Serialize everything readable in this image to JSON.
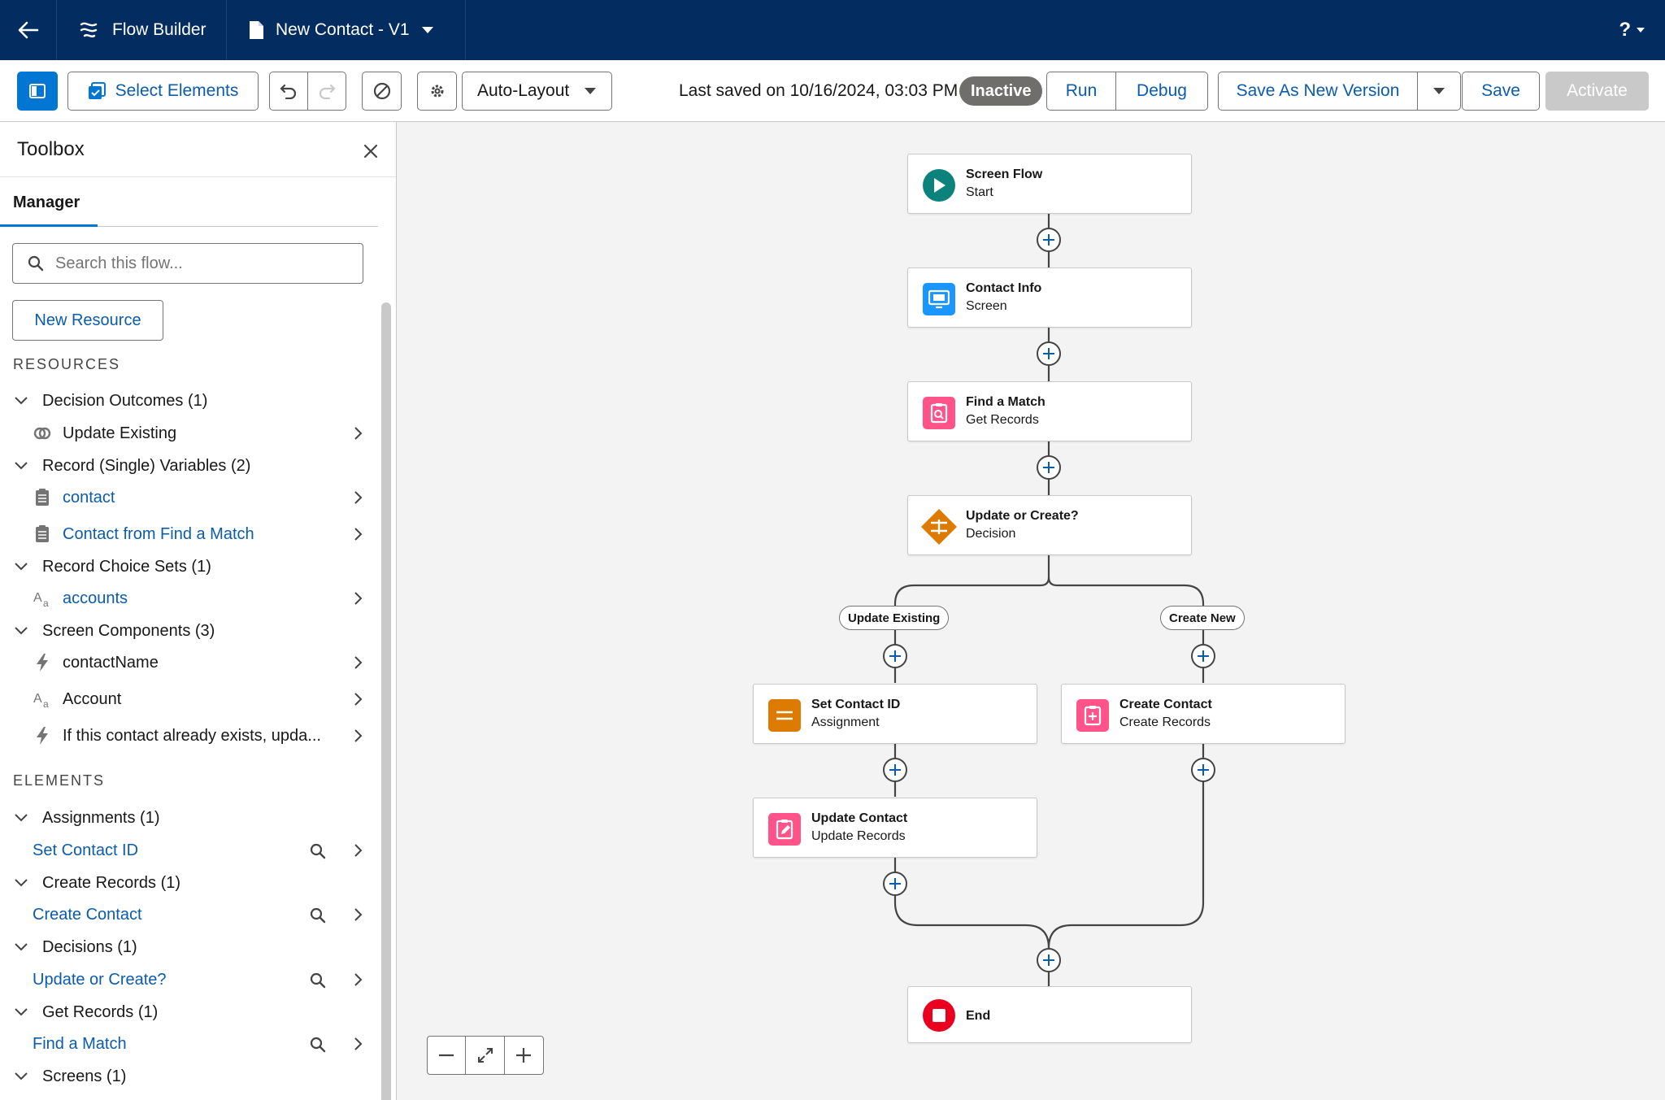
{
  "header": {
    "app_title": "Flow Builder",
    "flow_name": "New Contact - V1",
    "help_label": "?"
  },
  "toolbar": {
    "select_elements": "Select Elements",
    "layout_mode": "Auto-Layout",
    "last_saved": "Last saved on 10/16/2024, 03:03 PM",
    "status_badge": "Inactive",
    "run": "Run",
    "debug": "Debug",
    "save_as_new_version": "Save As New Version",
    "save": "Save",
    "activate": "Activate"
  },
  "toolbox": {
    "title": "Toolbox",
    "tab": "Manager",
    "search_placeholder": "Search this flow...",
    "new_resource": "New Resource",
    "resources_heading": "RESOURCES",
    "resource_groups": [
      {
        "label": "Decision Outcomes (1)",
        "items": [
          {
            "label": "Update Existing",
            "icon": "outcome-icon"
          }
        ]
      },
      {
        "label": "Record (Single) Variables (2)",
        "items": [
          {
            "label": "contact",
            "icon": "record-variable-icon"
          },
          {
            "label": "Contact from Find a Match",
            "icon": "record-variable-icon"
          }
        ]
      },
      {
        "label": "Record Choice Sets (1)",
        "items": [
          {
            "label": "accounts",
            "icon": "text-icon"
          }
        ]
      },
      {
        "label": "Screen Components (3)",
        "items": [
          {
            "label": "contactName",
            "icon": "lightning-icon"
          },
          {
            "label": "Account",
            "icon": "text-icon"
          },
          {
            "label": "If this contact already exists, upda...",
            "icon": "lightning-icon"
          }
        ]
      }
    ],
    "elements_heading": "ELEMENTS",
    "element_groups": [
      {
        "label": "Assignments (1)",
        "items": [
          "Set Contact ID"
        ]
      },
      {
        "label": "Create Records (1)",
        "items": [
          "Create Contact"
        ]
      },
      {
        "label": "Decisions (1)",
        "items": [
          "Update or Create?"
        ]
      },
      {
        "label": "Get Records (1)",
        "items": [
          "Find a Match"
        ]
      },
      {
        "label": "Screens (1)",
        "items": []
      }
    ]
  },
  "canvas": {
    "nodes": {
      "start": {
        "title": "Screen Flow",
        "sub": "Start",
        "color": "#0b827c"
      },
      "screen": {
        "title": "Contact Info",
        "sub": "Screen",
        "color": "#1b96ff"
      },
      "get": {
        "title": "Find a Match",
        "sub": "Get Records",
        "color": "#ff538a"
      },
      "decision": {
        "title": "Update or Create?",
        "sub": "Decision",
        "color": "#dd7a01"
      },
      "assign": {
        "title": "Set Contact ID",
        "sub": "Assignment",
        "color": "#dd7a01"
      },
      "create": {
        "title": "Create Contact",
        "sub": "Create Records",
        "color": "#ff538a"
      },
      "update": {
        "title": "Update Contact",
        "sub": "Update Records",
        "color": "#ff538a"
      },
      "end": {
        "title": "End",
        "color": "#ea001e"
      }
    },
    "branch_labels": {
      "left": "Update Existing",
      "right": "Create New"
    }
  }
}
